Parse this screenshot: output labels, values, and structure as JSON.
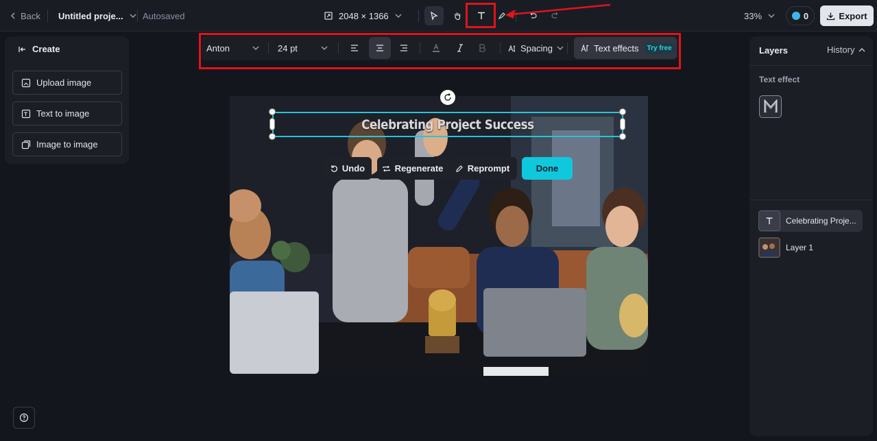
{
  "topbar": {
    "back_label": "Back",
    "project_name": "Untitled proje...",
    "autosave_label": "Autosaved",
    "canvas_size": "2048 × 1366",
    "zoom": "33%",
    "credits": "0",
    "export_label": "Export"
  },
  "left_panel": {
    "create_label": "Create",
    "buttons": [
      {
        "label": "Upload image",
        "icon": "upload-image-icon"
      },
      {
        "label": "Text to image",
        "icon": "text-to-image-icon"
      },
      {
        "label": "Image to image",
        "icon": "image-to-image-icon"
      }
    ]
  },
  "text_toolbar": {
    "font": "Anton",
    "size": "24 pt",
    "spacing_label": "Spacing",
    "effects_label": "Text effects",
    "try_free": "Try free"
  },
  "canvas": {
    "text": "Celebrating Project Success",
    "actions": {
      "undo": "Undo",
      "regenerate": "Regenerate",
      "reprompt": "Reprompt",
      "done": "Done"
    }
  },
  "right_panel": {
    "layers_label": "Layers",
    "history_label": "History",
    "text_effect_label": "Text effect",
    "layers": [
      {
        "name": "Celebrating Proje...",
        "type": "text",
        "selected": true
      },
      {
        "name": "Layer 1",
        "type": "image",
        "selected": false
      }
    ]
  },
  "colors": {
    "accent": "#10c8dc",
    "annotation_red": "#e1141b",
    "background": "#14161d"
  }
}
